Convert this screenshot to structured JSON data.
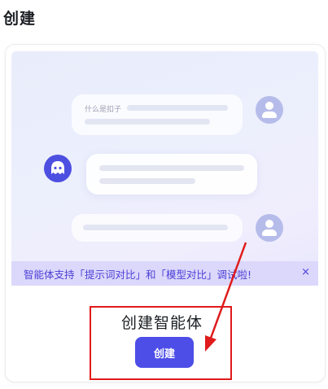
{
  "page": {
    "title": "创建"
  },
  "preview": {
    "question_text": "什么是扣子",
    "banner_text": "智能体支持「提示词对比」和「模型对比」调试啦!",
    "close_icon": "×"
  },
  "create_section": {
    "heading": "创建智能体",
    "button_label": "创建"
  },
  "colors": {
    "accent": "#4d4de8",
    "banner_bg": "#dcd8fb",
    "banner_text": "#4b3fd6",
    "annotation": "#e01b1b"
  }
}
